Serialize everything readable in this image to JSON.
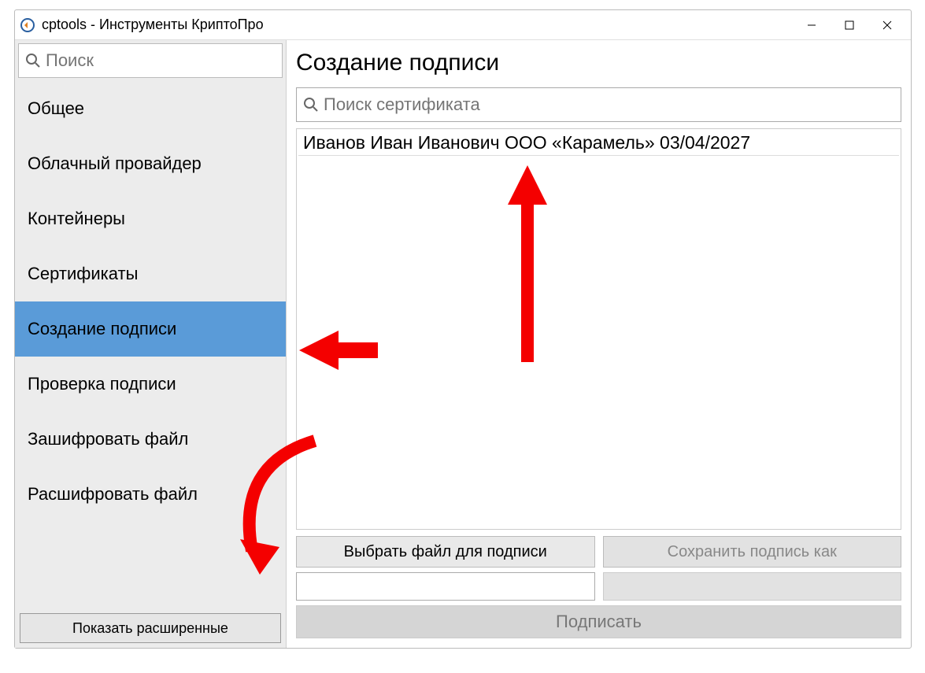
{
  "window": {
    "title": "cptools - Инструменты КриптоПро"
  },
  "sidebar": {
    "search_placeholder": "Поиск",
    "items": [
      {
        "label": "Общее",
        "active": false
      },
      {
        "label": "Облачный провайдер",
        "active": false
      },
      {
        "label": "Контейнеры",
        "active": false
      },
      {
        "label": "Сертификаты",
        "active": false
      },
      {
        "label": "Создание подписи",
        "active": true
      },
      {
        "label": "Проверка подписи",
        "active": false
      },
      {
        "label": "Зашифровать файл",
        "active": false
      },
      {
        "label": "Расшифровать файл",
        "active": false
      }
    ],
    "show_advanced_label": "Показать расширенные"
  },
  "main": {
    "title": "Создание подписи",
    "cert_search_placeholder": "Поиск сертификата",
    "certificates": [
      "Иванов Иван Иванович ООО «Карамель» 03/04/2027"
    ],
    "choose_file_label": "Выбрать файл для подписи",
    "save_sig_label": "Сохранить подпись как",
    "sign_label": "Подписать"
  },
  "annotations": {
    "color": "#f40000"
  }
}
